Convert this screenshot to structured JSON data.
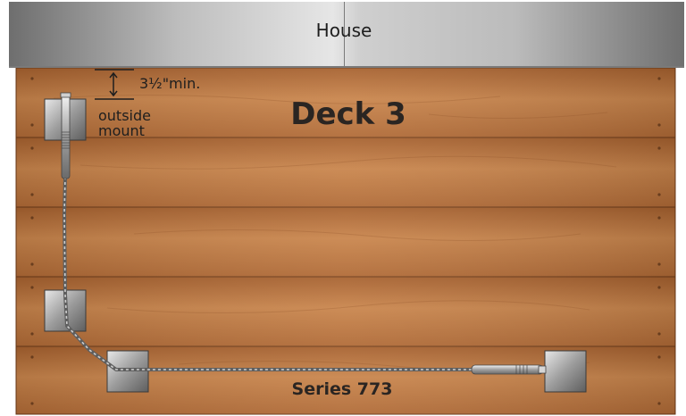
{
  "house": {
    "label": "House"
  },
  "deck": {
    "title": "Deck 3"
  },
  "series": {
    "label": "Series 773"
  },
  "annotations": {
    "min_spacing": "3½\"min.",
    "mount_line1": "outside",
    "mount_line2": "mount"
  },
  "colors": {
    "deck_wood": "#c07a44",
    "deck_wood_dark": "#8d5026",
    "house_gray": "#bdbdbd",
    "post_steel": "#a8a8a8",
    "cable": "#7d7d7d"
  }
}
